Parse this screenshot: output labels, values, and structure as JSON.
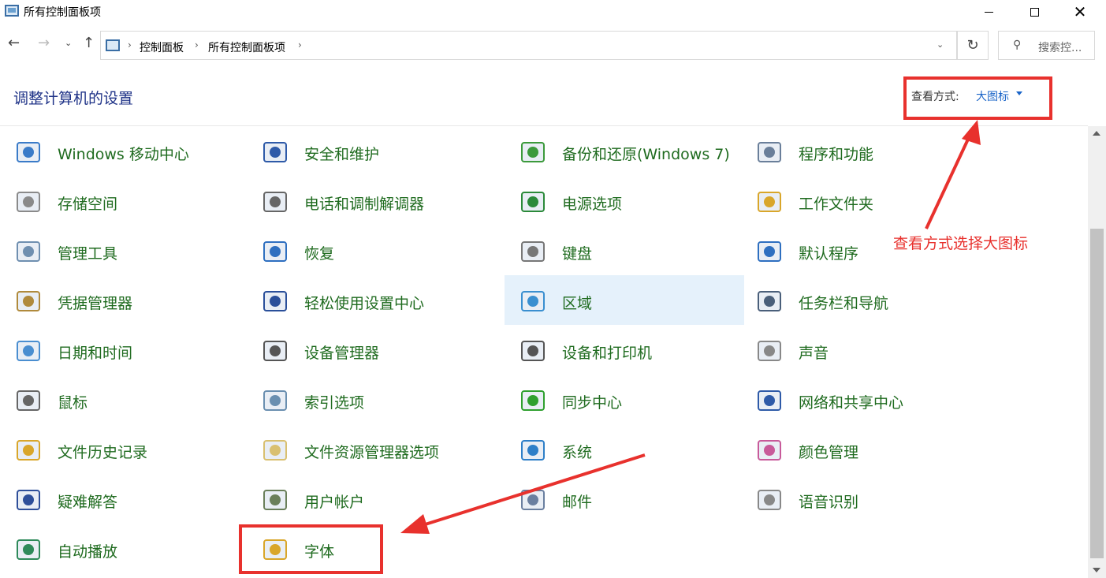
{
  "window": {
    "title": "所有控制面板项"
  },
  "address": {
    "breadcrumb": [
      "控制面板",
      "所有控制面板项"
    ],
    "search_placeholder": "搜索控..."
  },
  "header": {
    "title": "调整计算机的设置",
    "view_label": "查看方式:",
    "view_value": "大图标"
  },
  "annotation": {
    "text": "查看方式选择大图标",
    "color": "#e8312d"
  },
  "items": [
    {
      "label": "Windows 移动中心",
      "icon": "mobility-center-icon"
    },
    {
      "label": "安全和维护",
      "icon": "flag-icon"
    },
    {
      "label": "备份和还原(Windows 7)",
      "icon": "backup-icon"
    },
    {
      "label": "程序和功能",
      "icon": "programs-icon"
    },
    {
      "label": "存储空间",
      "icon": "storage-icon"
    },
    {
      "label": "电话和调制解调器",
      "icon": "phone-icon"
    },
    {
      "label": "电源选项",
      "icon": "battery-icon"
    },
    {
      "label": "工作文件夹",
      "icon": "work-folder-icon"
    },
    {
      "label": "管理工具",
      "icon": "admin-tools-icon"
    },
    {
      "label": "恢复",
      "icon": "recovery-icon"
    },
    {
      "label": "键盘",
      "icon": "keyboard-icon"
    },
    {
      "label": "默认程序",
      "icon": "default-programs-icon"
    },
    {
      "label": "凭据管理器",
      "icon": "credential-safe-icon"
    },
    {
      "label": "轻松使用设置中心",
      "icon": "ease-of-access-icon"
    },
    {
      "label": "区域",
      "icon": "globe-clock-icon",
      "selected": true
    },
    {
      "label": "任务栏和导航",
      "icon": "taskbar-icon"
    },
    {
      "label": "日期和时间",
      "icon": "calendar-clock-icon"
    },
    {
      "label": "设备管理器",
      "icon": "device-manager-icon"
    },
    {
      "label": "设备和打印机",
      "icon": "printer-icon"
    },
    {
      "label": "声音",
      "icon": "speaker-icon"
    },
    {
      "label": "鼠标",
      "icon": "mouse-icon"
    },
    {
      "label": "索引选项",
      "icon": "indexing-icon"
    },
    {
      "label": "同步中心",
      "icon": "sync-icon"
    },
    {
      "label": "网络和共享中心",
      "icon": "network-icon"
    },
    {
      "label": "文件历史记录",
      "icon": "file-history-icon"
    },
    {
      "label": "文件资源管理器选项",
      "icon": "folder-options-icon"
    },
    {
      "label": "系统",
      "icon": "computer-icon"
    },
    {
      "label": "颜色管理",
      "icon": "color-management-icon"
    },
    {
      "label": "疑难解答",
      "icon": "troubleshoot-icon"
    },
    {
      "label": "用户帐户",
      "icon": "users-icon"
    },
    {
      "label": "邮件",
      "icon": "mail-icon"
    },
    {
      "label": "语音识别",
      "icon": "microphone-icon"
    },
    {
      "label": "自动播放",
      "icon": "autoplay-icon"
    },
    {
      "label": "字体",
      "icon": "fonts-icon"
    }
  ]
}
